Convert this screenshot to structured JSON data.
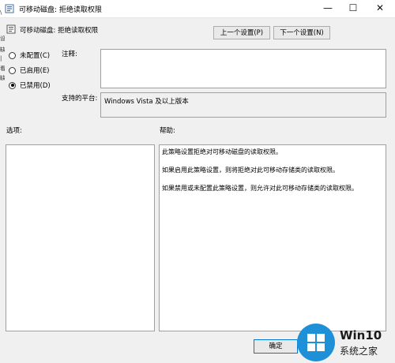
{
  "window": {
    "title": "可移动磁盘: 拒绝读取权限",
    "minimize_glyph": "—",
    "maximize_glyph": "☐",
    "close_glyph": "✕"
  },
  "left_edge_glyphs": [
    "\\",
    "设",
    "缺",
    "|",
    "看",
    "缺"
  ],
  "header": {
    "policy_name": "可移动磁盘: 拒绝读取权限",
    "prev_button": "上一个设置(P)",
    "next_button": "下一个设置(N)"
  },
  "state_options": [
    {
      "label": "未配置(C)",
      "checked": false
    },
    {
      "label": "已启用(E)",
      "checked": false
    },
    {
      "label": "已禁用(D)",
      "checked": true
    }
  ],
  "comment": {
    "label": "注释:",
    "value": ""
  },
  "platform": {
    "label": "支持的平台:",
    "value": "Windows Vista 及以上版本"
  },
  "options_label": "选项:",
  "help_label": "帮助:",
  "help_paragraphs": [
    "此策略设置拒绝对可移动磁盘的读取权限。",
    "如果启用此策略设置，则将拒绝对此可移动存储类的读取权限。",
    "如果禁用或未配置此策略设置，则允许对此可移动存储类的读取权限。"
  ],
  "ok_button": "确定",
  "watermark": {
    "brand": "Win10",
    "subtitle": "系统之家",
    "logo_color": "#1e90d8"
  }
}
